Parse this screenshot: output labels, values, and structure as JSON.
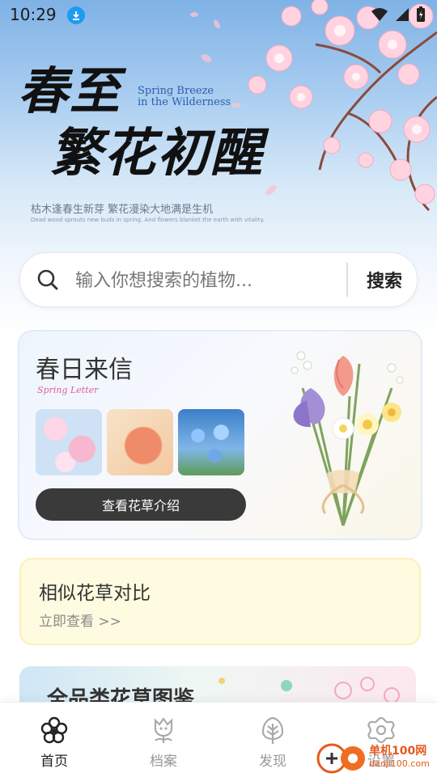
{
  "status_bar": {
    "time": "10:29"
  },
  "hero": {
    "title_line1": "春至",
    "title_line2": "繁花初醒",
    "title_en": "Spring Breeze\nin the Wilderness",
    "tagline": "枯木逢春生新芽 繁花漫染大地满是生机",
    "tagline_en": "Dead wood sprouts new buds in spring. And flowers blanket the earth with vitality."
  },
  "search": {
    "placeholder": "输入你想搜索的植物...",
    "value": "",
    "button_label": "搜索"
  },
  "spring_letter": {
    "title": "春日来信",
    "subtitle": "Spring  Letter",
    "button_label": "查看花草介绍"
  },
  "compare": {
    "title": "相似花草对比",
    "link": "立即查看  >>"
  },
  "encyclopedia": {
    "title": "全品类花草图鉴"
  },
  "nav": {
    "items": [
      {
        "label": "首页",
        "icon": "flower-icon",
        "active": true
      },
      {
        "label": "档案",
        "icon": "tulip-icon",
        "active": false
      },
      {
        "label": "发现",
        "icon": "leaf-icon",
        "active": false
      },
      {
        "label": "设置",
        "icon": "gear-icon",
        "active": false
      }
    ]
  },
  "watermark": {
    "line1": "单机100网",
    "line2": "danji100.com"
  },
  "colors": {
    "accent": "#1e9bf0",
    "button_dark": "#3a3a3a",
    "subtitle_pink": "#e0609a",
    "compare_bg": "#fffbe0"
  }
}
